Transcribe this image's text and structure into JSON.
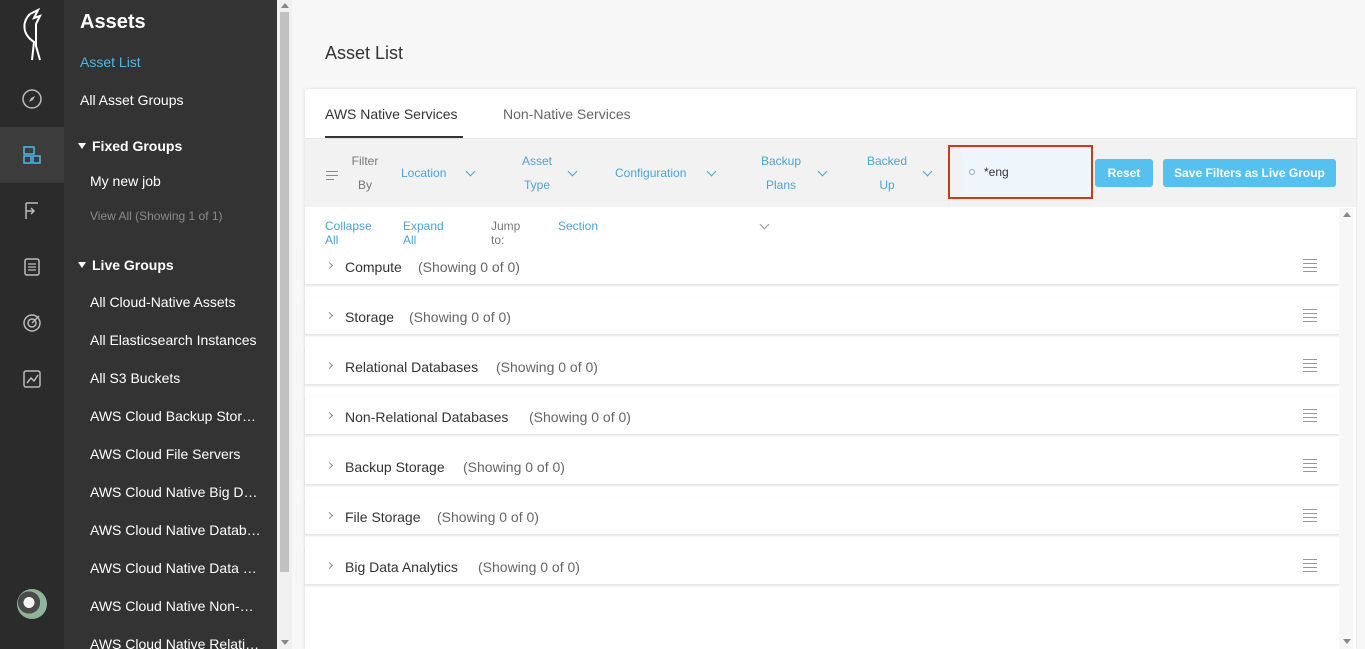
{
  "sidebar": {
    "title": "Assets",
    "links": [
      "Asset List",
      "All Asset Groups"
    ],
    "fixed_groups": {
      "label": "Fixed Groups",
      "items": [
        "My new job"
      ],
      "view_all": "View All (Showing 1 of 1)"
    },
    "live_groups": {
      "label": "Live Groups",
      "items": [
        "All Cloud-Native Assets",
        "All Elasticsearch Instances",
        "All S3 Buckets",
        "AWS Cloud Backup Storage",
        "AWS Cloud File Servers",
        "AWS Cloud Native Big Data",
        "AWS Cloud Native Databases",
        "AWS Cloud Native Data Warehouses",
        "AWS Cloud Native Non-Relational",
        "AWS Cloud Native Relational"
      ]
    }
  },
  "main": {
    "title": "Asset List",
    "tabs": [
      "AWS Native Services",
      "Non-Native Services"
    ],
    "filter": {
      "label_line1": "Filter",
      "label_line2": "By",
      "location": "Location",
      "asset_type_1": "Asset",
      "asset_type_2": "Type",
      "configuration": "Configuration",
      "backup_plans_1": "Backup",
      "backup_plans_2": "Plans",
      "backed_up_1": "Backed",
      "backed_up_2": "Up",
      "search_value": "*eng",
      "reset": "Reset",
      "save": "Save Filters as Live Group"
    },
    "controls": {
      "collapse": "Collapse All",
      "expand": "Expand All",
      "jump_label": "Jump to:",
      "jump_value": "Section"
    },
    "sections": [
      {
        "name": "Compute",
        "count": "(Showing 0 of 0)"
      },
      {
        "name": "Storage",
        "count": "(Showing 0 of 0)"
      },
      {
        "name": "Relational Databases",
        "count": "(Showing 0 of 0)"
      },
      {
        "name": "Non-Relational Databases",
        "count": "(Showing 0 of 0)"
      },
      {
        "name": "Backup Storage",
        "count": "(Showing 0 of 0)"
      },
      {
        "name": "File Storage",
        "count": "(Showing 0 of 0)"
      },
      {
        "name": "Big Data Analytics",
        "count": "(Showing 0 of 0)"
      }
    ]
  },
  "colors": {
    "accent": "#4da3d6",
    "button": "#56c0ef",
    "highlight": "#cc3a1a",
    "sidebar": "#333333",
    "rail": "#2b2b2b"
  },
  "icons": [
    "logo-icon",
    "compass-icon",
    "assets-icon",
    "policy-icon",
    "reports-icon",
    "target-icon",
    "chart-icon"
  ]
}
